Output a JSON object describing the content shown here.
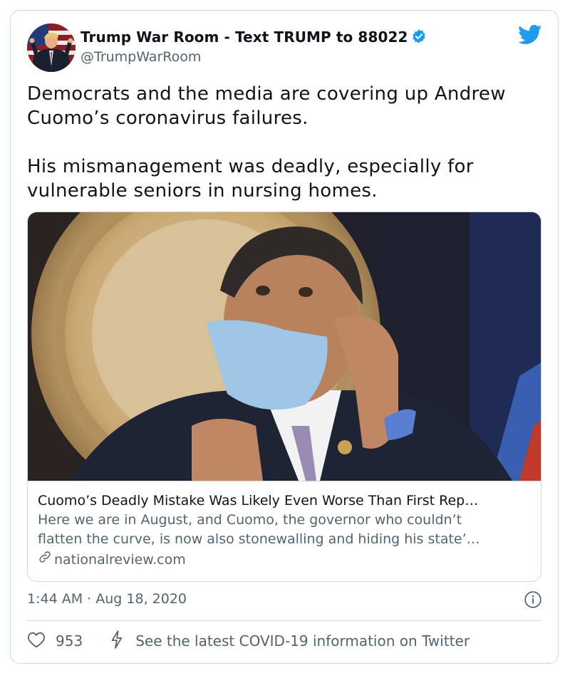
{
  "author": {
    "display_name": "Trump War Room - Text TRUMP to 88022",
    "handle": "@TrumpWarRoom",
    "verified": true
  },
  "tweet": {
    "paragraphs": [
      "Democrats and the media are covering up Andrew Cuomo’s coronavirus failures.",
      "His mismanagement was deadly, especially for vulnerable seniors in nursing homes."
    ]
  },
  "link_card": {
    "title": "Cuomo’s Deadly Mistake Was Likely Even Worse Than First Rep…",
    "description_lines": [
      "Here we are in August, and Cuomo, the governor who couldn’t",
      "flatten the curve, is now also stonewalling and hiding his state’…"
    ],
    "domain": "nationalreview.com"
  },
  "meta": {
    "time": "1:44 AM",
    "separator": "·",
    "date": "Aug 18, 2020"
  },
  "actions": {
    "likes": "953",
    "covid_notice": "See the latest COVID-19 information on Twitter"
  },
  "colors": {
    "twitter_blue": "#1d9bf0",
    "secondary_text": "#536471",
    "border": "#cfd9de"
  },
  "icons": [
    "verified-badge-icon",
    "twitter-bird-icon",
    "link-icon",
    "info-icon",
    "heart-icon",
    "lightning-icon"
  ]
}
